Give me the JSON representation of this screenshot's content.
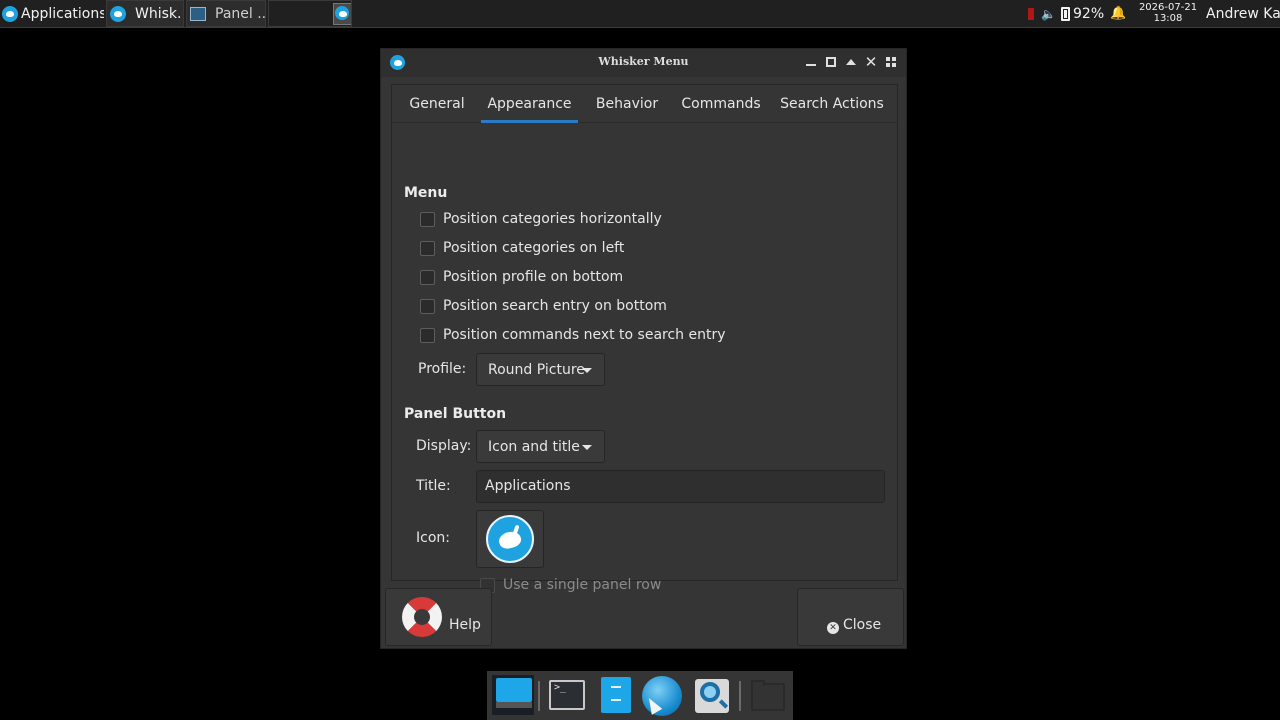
{
  "top_panel": {
    "applications_label": "Applications",
    "tasks": [
      {
        "label": "Whisk...",
        "icon": "xfce-mouse-icon"
      },
      {
        "label": "Panel ...",
        "icon": "window-icon"
      }
    ],
    "battery_percent": "92%",
    "clock_date": "2026-07-21",
    "clock_time": "13:08",
    "user": "Andrew Kay"
  },
  "dialog": {
    "title": "Whisker Menu",
    "tabs": [
      "General",
      "Appearance",
      "Behavior",
      "Commands",
      "Search Actions"
    ],
    "active_tab": "Appearance",
    "menu_section": {
      "title": "Menu",
      "options": [
        {
          "label": "Position categories horizontally",
          "checked": false
        },
        {
          "label": "Position categories on left",
          "checked": false
        },
        {
          "label": "Position profile on bottom",
          "checked": false
        },
        {
          "label": "Position search entry on bottom",
          "checked": false
        },
        {
          "label": "Position commands next to search entry",
          "checked": false
        }
      ],
      "profile_label": "Profile:",
      "profile_value": "Round Picture"
    },
    "panel_button_section": {
      "title": "Panel Button",
      "display_label": "Display:",
      "display_value": "Icon and title",
      "title_label": "Title:",
      "title_value": "Applications",
      "icon_label": "Icon:",
      "single_row_label": "Use a single panel row",
      "single_row_checked": false
    },
    "help_label": "Help",
    "close_label": "Close"
  },
  "dock": {
    "items": [
      "desktop-icon",
      "terminal-icon",
      "file-manager-icon",
      "web-browser-icon",
      "search-icon",
      "folder-icon"
    ]
  },
  "colors": {
    "accent": "#2a7cc7",
    "xfce_blue": "#1fa2e0",
    "panel_border": "#8b1a1a"
  }
}
